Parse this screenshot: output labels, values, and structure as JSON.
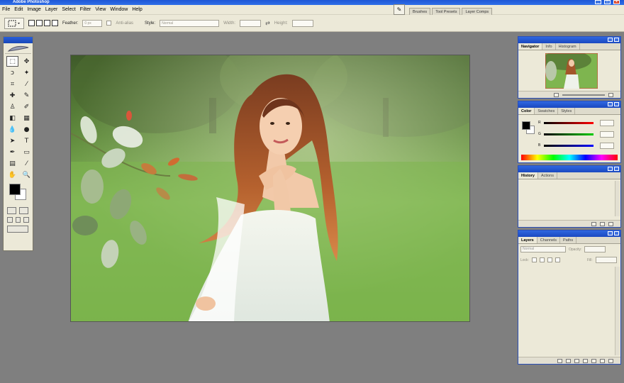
{
  "window": {
    "title": "Adobe Photoshop"
  },
  "menu": [
    "File",
    "Edit",
    "Image",
    "Layer",
    "Select",
    "Filter",
    "View",
    "Window",
    "Help"
  ],
  "options": {
    "feather_label": "Feather:",
    "feather_value": "0 px",
    "antialias_label": "Anti-alias",
    "style_label": "Style:",
    "style_value": "Normal",
    "width_label": "Width:",
    "height_label": "Height:"
  },
  "palette_well": [
    "Brushes",
    "Tool Presets",
    "Layer Comps"
  ],
  "navigator": {
    "tabs": [
      "Navigator",
      "Info",
      "Histogram"
    ]
  },
  "color": {
    "tabs": [
      "Color",
      "Swatches",
      "Styles"
    ],
    "channels": [
      "R",
      "G",
      "B"
    ]
  },
  "history": {
    "tabs": [
      "History",
      "Actions"
    ]
  },
  "layers": {
    "tabs": [
      "Layers",
      "Channels",
      "Paths"
    ],
    "blend_mode": "Normal",
    "opacity_label": "Opacity:",
    "lock_label": "Lock:",
    "fill_label": "Fill:"
  }
}
